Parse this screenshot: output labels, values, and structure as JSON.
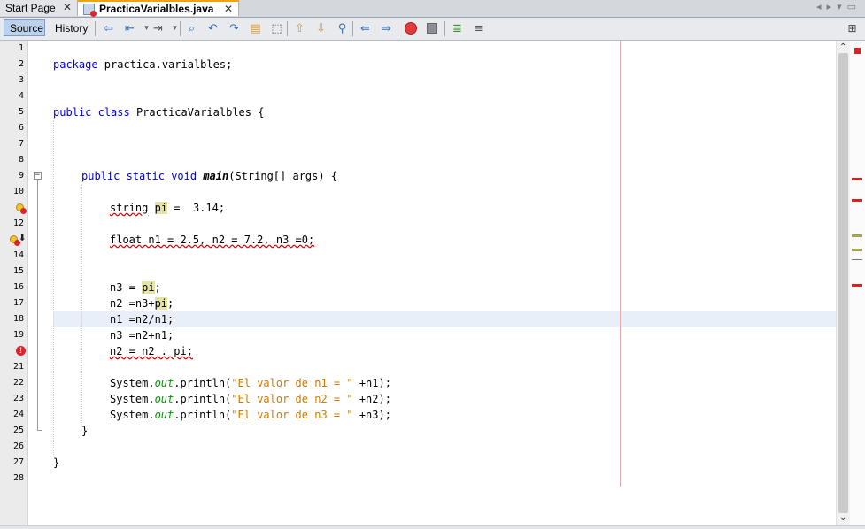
{
  "tabs": [
    {
      "label": "Start Page",
      "close": "✕"
    },
    {
      "label": "PracticaVarialbles.java",
      "close": "✕"
    }
  ],
  "toolbar": {
    "source_label": "Source",
    "history_label": "History"
  },
  "editor": {
    "line_numbers": [
      "1",
      "2",
      "3",
      "4",
      "5",
      "6",
      "7",
      "8",
      "9",
      "10",
      "",
      "12",
      "",
      "14",
      "15",
      "16",
      "17",
      "18",
      "19",
      "",
      "21",
      "22",
      "23",
      "24",
      "25",
      "26",
      "27",
      "28"
    ],
    "current_line": 18
  },
  "code": {
    "l2_kw": "package",
    "l2_rest": " practica.varialbles;",
    "l5_kw1": "public",
    "l5_kw2": "class",
    "l5_rest": " PracticaVarialbles {",
    "l9_kw1": "public",
    "l9_kw2": "static",
    "l9_kw3": "void",
    "l9_method": "main",
    "l9_rest": "(String[] args) {",
    "l11_type": "string",
    "l11_var": "pi",
    "l11_rest": " =  3.14;",
    "l13_text": "float n1 = 2.5, n2 = 7.2, n3 =0;",
    "l16_a": "n3 = ",
    "l16_var": "pi",
    "l16_b": ";",
    "l17_a": "n2 =n3+",
    "l17_var": "pi",
    "l17_b": ";",
    "l18_text": "n1 =n2/n1;",
    "l19_text": "n3 =n2+n1;",
    "l20_text": "n2 = n2 . pi;",
    "println_prefix": "System.",
    "println_field": "out",
    "println_call": ".println(",
    "l22_str": "\"El valor de n1 = \"",
    "l22_rest": " +n1);",
    "l23_str": "\"El valor de n2 = \"",
    "l23_rest": " +n2);",
    "l24_str": "\"El valor de n3 = \"",
    "l24_rest": " +n3);",
    "l25_text": "}",
    "l27_text": "}"
  },
  "colors": {
    "keyword": "#0000e6",
    "string": "#ce7b00",
    "field": "#009900",
    "error": "#e00000",
    "warning": "#a3a35a",
    "tab_accent": "#f0a30a"
  },
  "icons": [
    "search-icon",
    "find-previous-icon",
    "find-next-icon",
    "toggle-highlight-icon",
    "toggle-rect-selection-icon",
    "previous-bookmark-icon",
    "next-bookmark-icon",
    "toggle-bookmark-icon",
    "shift-left-icon",
    "shift-right-icon",
    "start-macro-icon",
    "stop-macro-icon",
    "comment-icon",
    "uncomment-icon",
    "split-editor-icon"
  ]
}
